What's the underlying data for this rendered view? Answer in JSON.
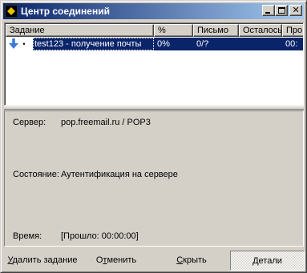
{
  "window": {
    "title": "Центр соединений"
  },
  "list": {
    "columns": [
      "Задание",
      "%",
      "Письмо",
      "Осталось",
      "Про"
    ],
    "rows": [
      {
        "cells": [
          "test123 - получение почты",
          "0%",
          "0/?",
          "",
          "00:"
        ]
      }
    ]
  },
  "details": {
    "server_label": "Сервер:",
    "server_value": "pop.freemail.ru / POP3",
    "state_label": "Состояние:",
    "state_value": "Аутентификация на сервере",
    "time_label": "Время:",
    "time_value": "[Прошло: 00:00:00]"
  },
  "buttons": {
    "delete_task": {
      "underlined": "У",
      "rest": "далить задание"
    },
    "cancel": {
      "pre": "О",
      "underlined": "т",
      "rest": "менить"
    },
    "hide": {
      "underlined": "С",
      "rest": "крыть"
    },
    "details": {
      "underlined": "Д",
      "rest": "етали"
    }
  }
}
